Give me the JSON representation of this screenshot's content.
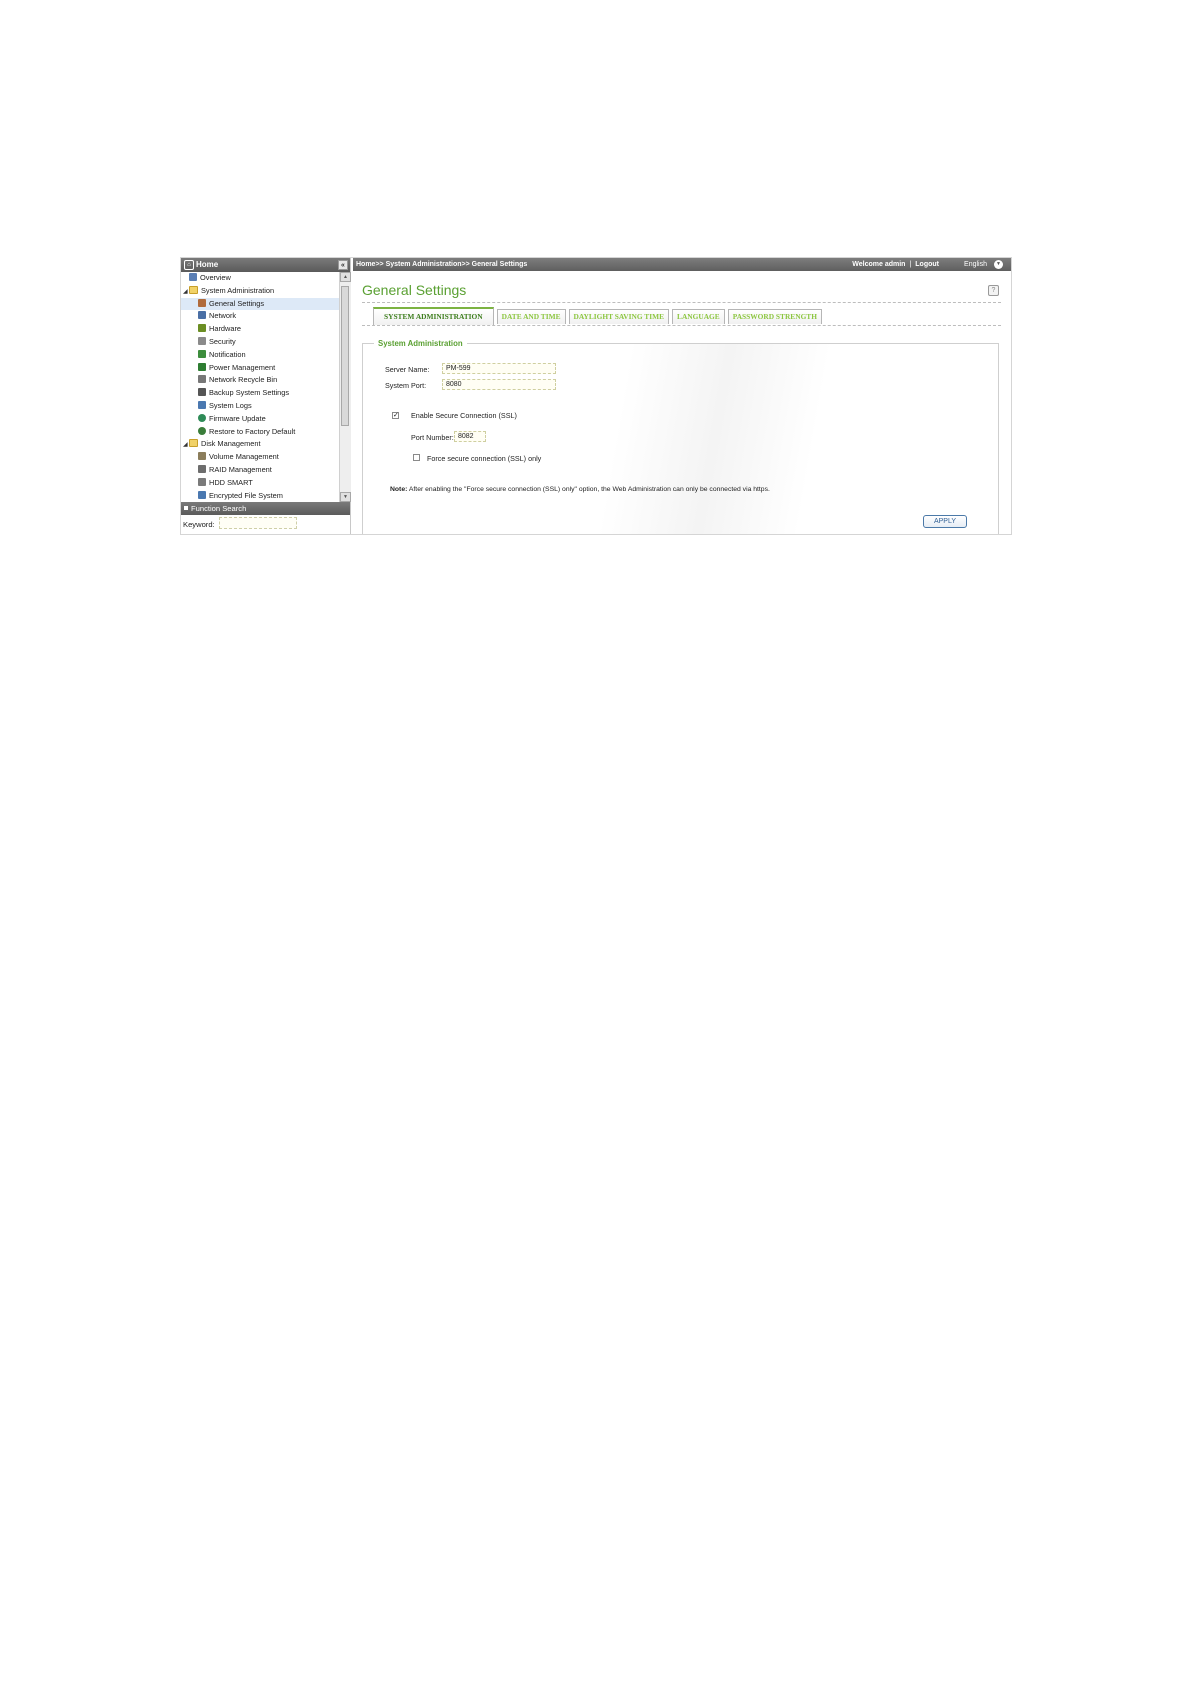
{
  "sidebar": {
    "header": "Home",
    "items": [
      {
        "label": "Overview",
        "level": 0,
        "icon": "overview-icon",
        "color": "#5b7fb5"
      },
      {
        "label": "System Administration",
        "level": 0,
        "icon": "folder-icon",
        "expanded": true
      },
      {
        "label": "General Settings",
        "level": 1,
        "icon": "settings-icon",
        "color": "#b06a3b",
        "selected": true
      },
      {
        "label": "Network",
        "level": 1,
        "icon": "network-icon",
        "color": "#4a6fa5"
      },
      {
        "label": "Hardware",
        "level": 1,
        "icon": "hardware-icon",
        "color": "#6b8e23"
      },
      {
        "label": "Security",
        "level": 1,
        "icon": "security-icon",
        "color": "#8a8a8a"
      },
      {
        "label": "Notification",
        "level": 1,
        "icon": "notification-icon",
        "color": "#3c8d3c"
      },
      {
        "label": "Power Management",
        "level": 1,
        "icon": "power-icon",
        "color": "#2e7d32"
      },
      {
        "label": "Network Recycle Bin",
        "level": 1,
        "icon": "recycle-bin-icon",
        "color": "#777777"
      },
      {
        "label": "Backup System Settings",
        "level": 1,
        "icon": "backup-icon",
        "color": "#555555"
      },
      {
        "label": "System Logs",
        "level": 1,
        "icon": "logs-icon",
        "color": "#4a78b0"
      },
      {
        "label": "Firmware Update",
        "level": 1,
        "icon": "firmware-icon",
        "color": "#2e8b57"
      },
      {
        "label": "Restore to Factory Default",
        "level": 1,
        "icon": "restore-icon",
        "color": "#3a7d3a"
      },
      {
        "label": "Disk Management",
        "level": 0,
        "icon": "folder-icon",
        "expanded": true
      },
      {
        "label": "Volume Management",
        "level": 1,
        "icon": "volume-icon",
        "color": "#8b7d5b"
      },
      {
        "label": "RAID Management",
        "level": 1,
        "icon": "raid-icon",
        "color": "#6d6d6d"
      },
      {
        "label": "HDD SMART",
        "level": 1,
        "icon": "hdd-icon",
        "color": "#7a7a7a"
      },
      {
        "label": "Encrypted File System",
        "level": 1,
        "icon": "encrypted-fs-icon",
        "color": "#4a78b0"
      }
    ]
  },
  "function_search": {
    "header": "Function Search",
    "keyword_label": "Keyword:",
    "keyword_value": ""
  },
  "topbar": {
    "breadcrumb": "Home>> System Administration>> General Settings",
    "welcome": "Welcome admin",
    "separator": "|",
    "logout": "Logout",
    "language": "English"
  },
  "page": {
    "title": "General Settings",
    "tabs": [
      "SYSTEM ADMINISTRATION",
      "DATE AND TIME",
      "DAYLIGHT SAVING TIME",
      "LANGUAGE",
      "PASSWORD STRENGTH"
    ],
    "active_tab": "SYSTEM ADMINISTRATION"
  },
  "form": {
    "legend": "System Administration",
    "server_name_label": "Server Name:",
    "server_name_value": "PM-599",
    "system_port_label": "System Port:",
    "system_port_value": "8080",
    "ssl_label": "Enable Secure Connection (SSL)",
    "ssl_checked": true,
    "port_number_label": "Port Number:",
    "port_number_value": "8082",
    "force_ssl_label": "Force secure connection (SSL) only",
    "force_ssl_checked": false,
    "note_label": "Note:",
    "note_text": "After enabling the \"Force secure connection (SSL) only\" option, the Web Administration can only be connected via https.",
    "apply_label": "APPLY"
  },
  "colors": {
    "accent_green": "#5aa032",
    "tab_green": "#8cc63f",
    "header_gray": "#6a6a6a",
    "selected_row": "#dde9f7"
  }
}
